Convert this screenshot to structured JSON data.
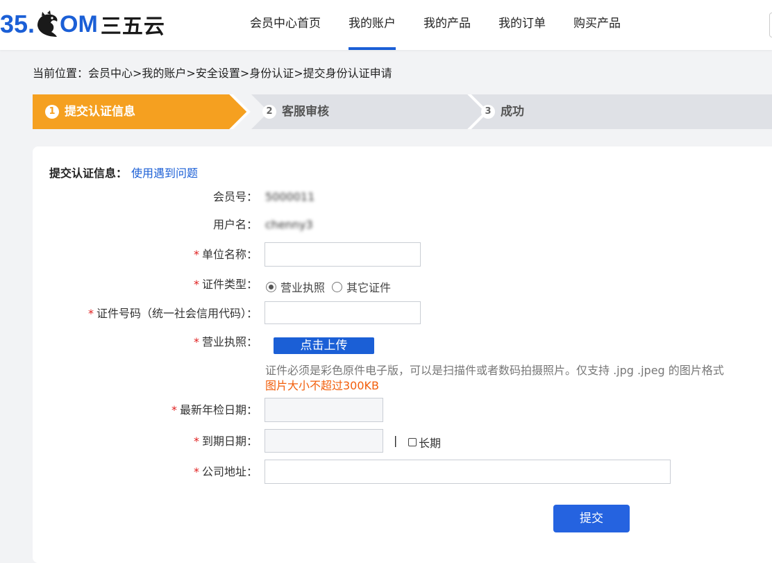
{
  "logo": {
    "num": "35.",
    "om": "OM",
    "cn": "三五云"
  },
  "nav": {
    "items": [
      {
        "label": "会员中心首页"
      },
      {
        "label": "我的账户"
      },
      {
        "label": "我的产品"
      },
      {
        "label": "我的订单"
      },
      {
        "label": "购买产品"
      }
    ],
    "active_index": 1
  },
  "breadcrumb": "当前位置：会员中心>我的账户>安全设置>身份认证>提交身份认证申请",
  "steps": [
    {
      "num": "1",
      "label": "提交认证信息"
    },
    {
      "num": "2",
      "label": "客服审核"
    },
    {
      "num": "3",
      "label": "成功"
    }
  ],
  "active_step": 0,
  "colors": {
    "accent": "#1b5fd6",
    "step_active": "#f5a020",
    "step_inactive": "#dfe1e6",
    "required": "#e02020",
    "warning": "#f25e0b"
  },
  "form": {
    "title": "提交认证信息：",
    "help_link": "使用遇到问题",
    "member_no_label": "会员号：",
    "member_no_value": "5000011",
    "username_label": "用户名：",
    "username_value": "chenny3",
    "required_mark": "*",
    "company_label": "单位名称：",
    "company_value": "",
    "cert_type_label": "证件类型：",
    "cert_type_options": [
      "营业执照",
      "其它证件"
    ],
    "cert_type_selected": "营业执照",
    "cert_no_label": "证件号码（统一社会信用代码）：",
    "cert_no_value": "",
    "license_label": "营业执照：",
    "upload_button": "点击上传",
    "upload_hint": "证件必须是彩色原件电子版，可以是扫描件或者数码拍摄照片。仅支持 .jpg .jpeg 的图片格式",
    "upload_limit": "图片大小不超过300KB",
    "inspection_label": "最新年检日期：",
    "inspection_value": "",
    "expiry_label": "到期日期：",
    "expiry_value": "",
    "separator": "|",
    "long_term_label": "长期",
    "long_term_checked": false,
    "address_label": "公司地址：",
    "address_value": "",
    "submit_label": "提交"
  }
}
